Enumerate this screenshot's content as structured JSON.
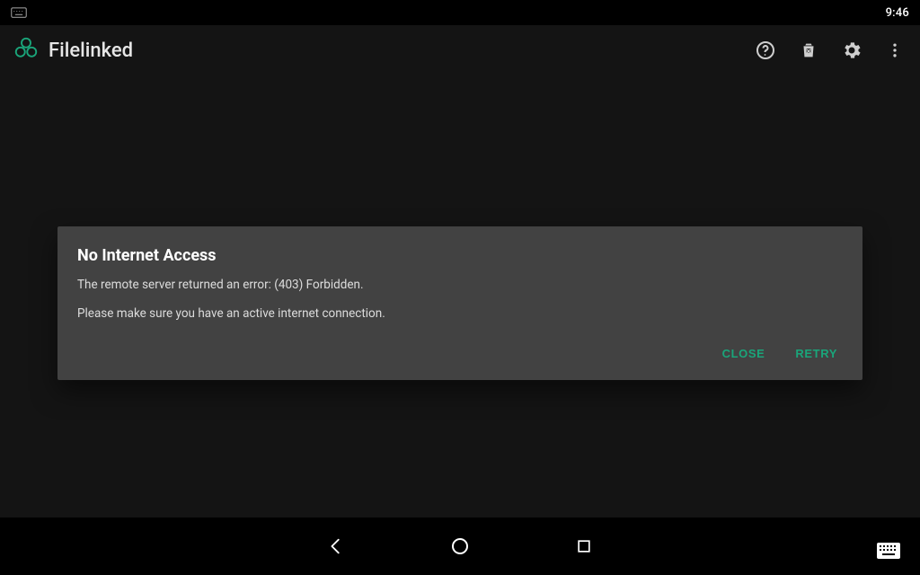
{
  "status": {
    "time": "9:46"
  },
  "app": {
    "title": "Filelinked",
    "icons": {
      "help": "help-icon",
      "delete": "delete-icon",
      "settings": "gear-icon",
      "overflow": "overflow-icon",
      "logo": "app-logo-icon"
    }
  },
  "dialog": {
    "title": "No Internet Access",
    "line1": "The remote server returned an error: (403) Forbidden.",
    "line2": "Please make sure you have an active internet connection.",
    "close": "CLOSE",
    "retry": "RETRY"
  },
  "nav": {
    "back": "back-icon",
    "home": "home-icon",
    "recents": "recents-icon",
    "keyboard": "keyboard-icon"
  },
  "colors": {
    "accent": "#1aa57a"
  }
}
